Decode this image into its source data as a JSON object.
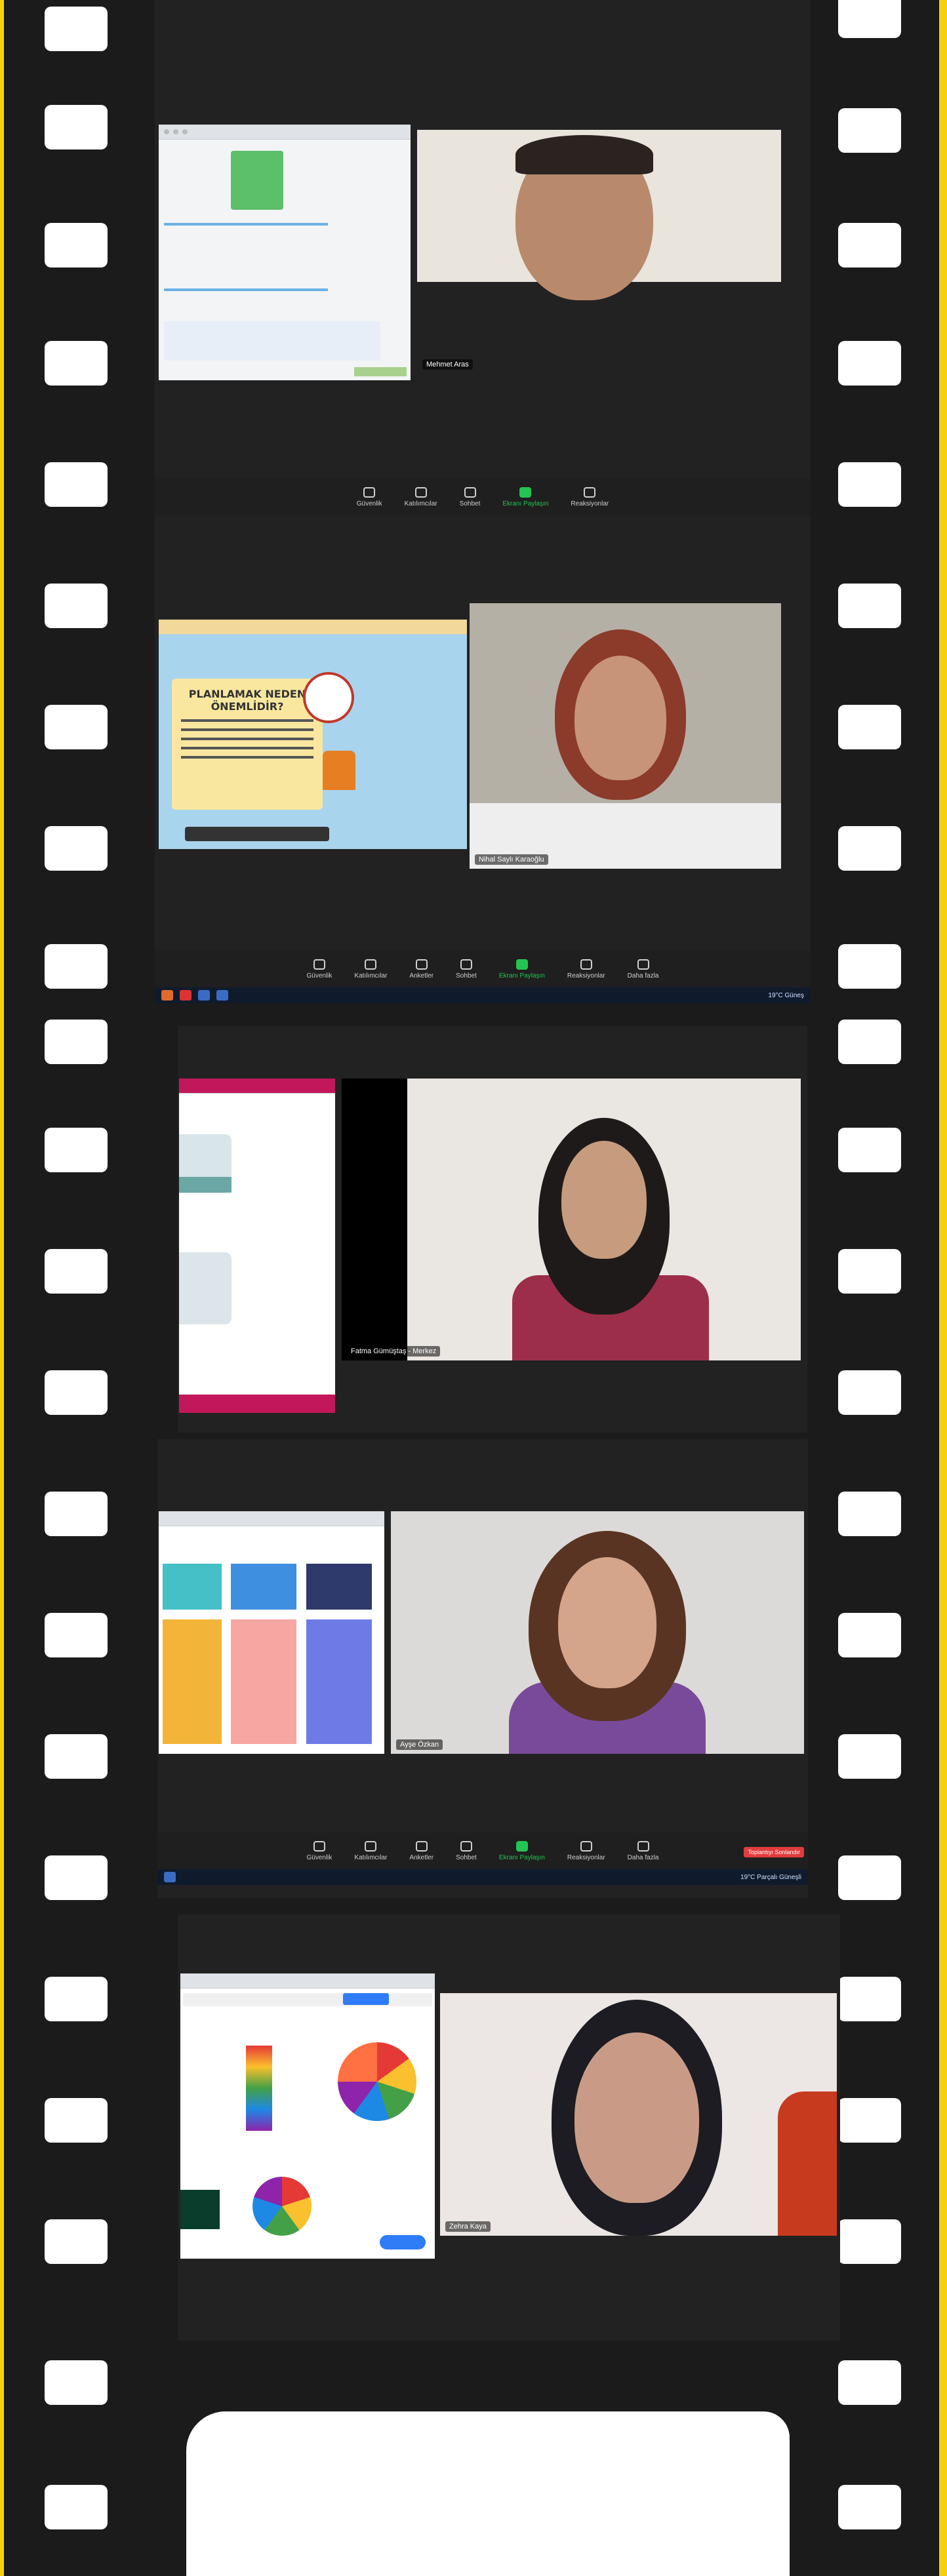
{
  "frames": [
    {
      "speaker_name": "Mehmet Aras",
      "toolbar": [
        "Güvenlik",
        "Katılımcılar",
        "Sohbet",
        "Ekranı Paylaşın",
        "Reaksiyonlar"
      ]
    },
    {
      "speaker_name": "Nihal Saylı Karaoğlu",
      "slide_title": "PLANLAMAK NEDEN ÖNEMLİDİR?",
      "toolbar": [
        "Güvenlik",
        "Katılımcılar",
        "Anketler",
        "Sohbet",
        "Ekranı Paylaşın",
        "Reaksiyonlar",
        "Daha fazla"
      ],
      "tray_text": "19°C Güneş"
    },
    {
      "speaker_name": "Fatma Gümüştaş - Merkez"
    },
    {
      "speaker_name": "Ayşe Özkan",
      "toolbar": [
        "Güvenlik",
        "Katılımcılar",
        "Anketler",
        "Sohbet",
        "Ekranı Paylaşın",
        "Reaksiyonlar",
        "Daha fazla"
      ],
      "end_button": "Toplantıyı Sonlandır",
      "tray_text": "19°C Parçalı Güneşli"
    },
    {
      "speaker_name": "Zehra Kaya"
    }
  ]
}
